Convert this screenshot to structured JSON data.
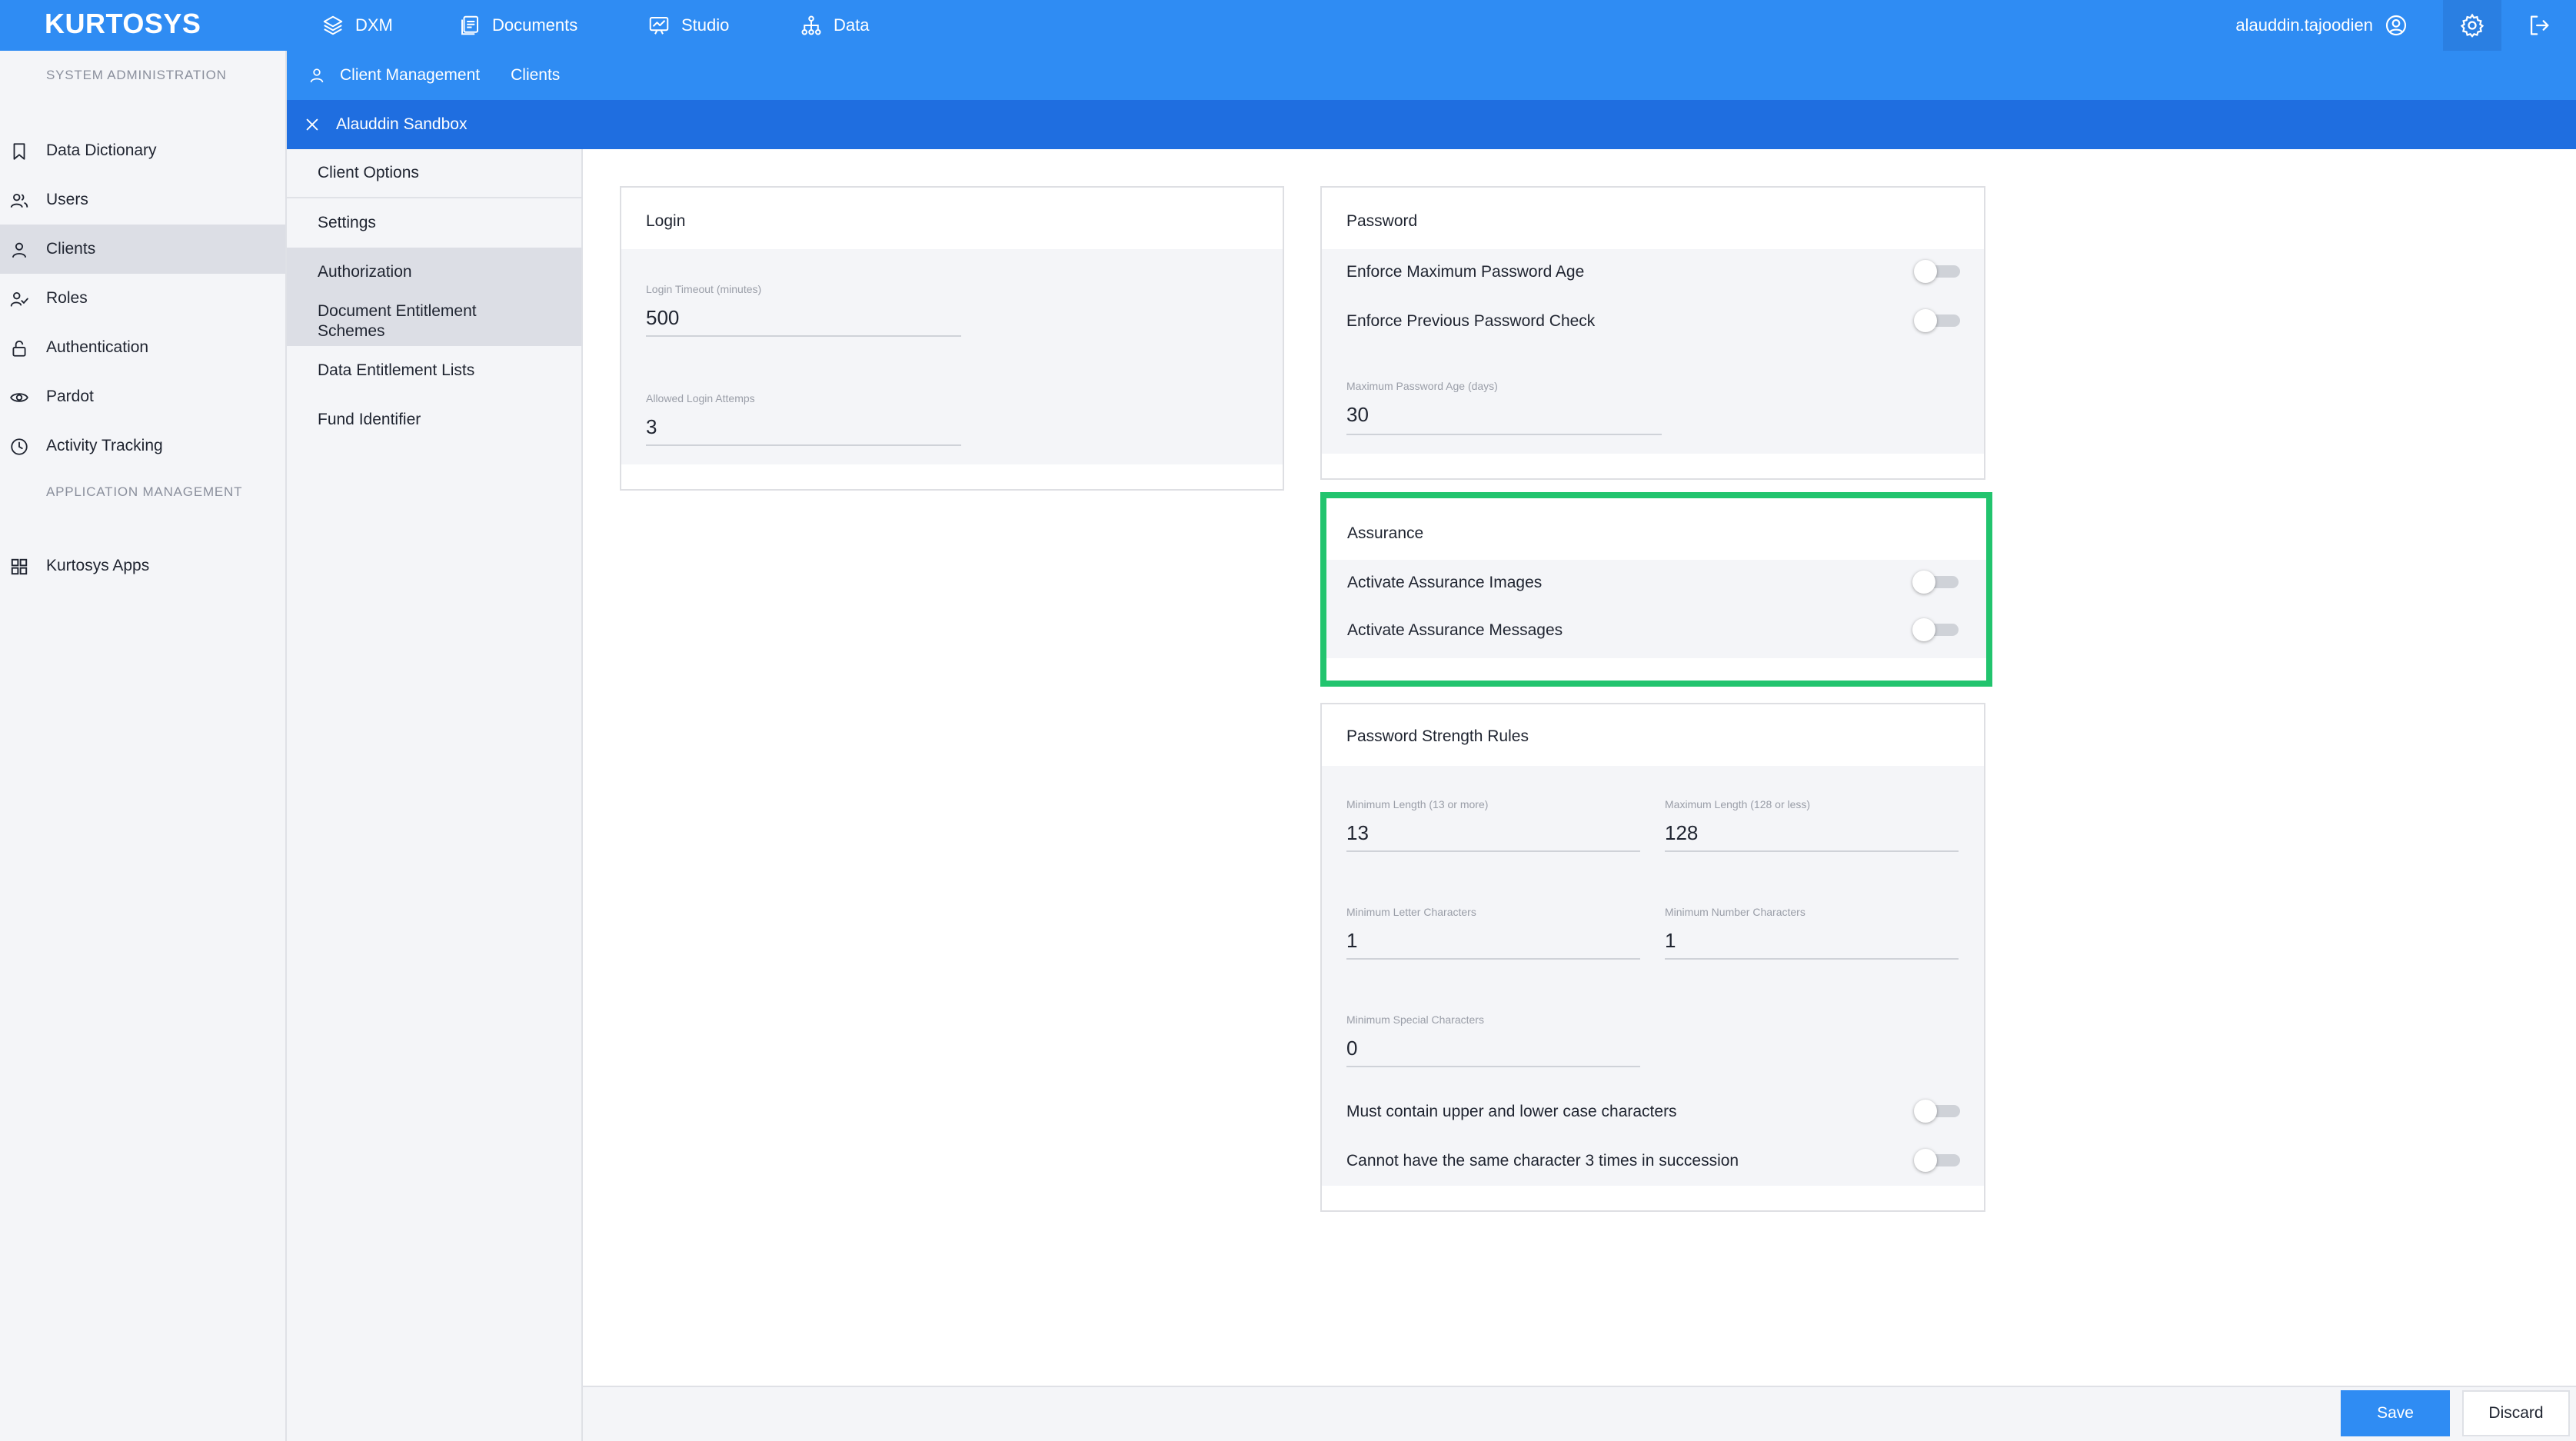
{
  "app": {
    "logo": "KURTOSYS"
  },
  "topnav": [
    {
      "label": "DXM",
      "icon": "layers-icon"
    },
    {
      "label": "Documents",
      "icon": "documents-icon"
    },
    {
      "label": "Studio",
      "icon": "chart-board-icon"
    },
    {
      "label": "Data",
      "icon": "hierarchy-icon"
    }
  ],
  "user": {
    "name": "alauddin.tajoodien",
    "icon": "user-circle-icon"
  },
  "sidebar": {
    "section_system": "SYSTEM ADMINISTRATION",
    "items": [
      {
        "label": "Data Dictionary",
        "icon": "bookmark-icon"
      },
      {
        "label": "Users",
        "icon": "users-icon"
      },
      {
        "label": "Clients",
        "icon": "person-icon",
        "active": true
      },
      {
        "label": "Roles",
        "icon": "person-check-icon"
      },
      {
        "label": "Authentication",
        "icon": "lock-icon"
      },
      {
        "label": "Pardot",
        "icon": "eye-icon"
      },
      {
        "label": "Activity Tracking",
        "icon": "clock-icon"
      }
    ],
    "section_app": "APPLICATION MANAGEMENT",
    "app_items": [
      {
        "label": "Kurtosys Apps",
        "icon": "grid-icon"
      }
    ]
  },
  "breadcrumb": {
    "root": "Client Management",
    "current": "Clients"
  },
  "tab": {
    "label": "Alauddin Sandbox"
  },
  "subnav": [
    {
      "label": "Client Options"
    },
    {
      "label": "Settings"
    },
    {
      "label": "Authorization",
      "active": true
    },
    {
      "label": "Document Entitlement Schemes",
      "active": true
    },
    {
      "label": "Data Entitlement Lists"
    },
    {
      "label": "Fund Identifier"
    }
  ],
  "login": {
    "title": "Login",
    "timeout_label": "Login Timeout (minutes)",
    "timeout_value": "500",
    "attempts_label": "Allowed Login Attemps",
    "attempts_value": "3"
  },
  "password": {
    "title": "Password",
    "enforce_max_age": "Enforce Maximum Password Age",
    "enforce_prev_check": "Enforce Previous Password Check",
    "max_age_label": "Maximum Password Age (days)",
    "max_age_value": "30"
  },
  "assurance": {
    "title": "Assurance",
    "images": "Activate Assurance Images",
    "messages": "Activate Assurance Messages"
  },
  "strength": {
    "title": "Password Strength Rules",
    "min_length_label": "Minimum Length (13 or more)",
    "min_length_value": "13",
    "max_length_label": "Maximum Length (128 or less)",
    "max_length_value": "128",
    "min_letter_label": "Minimum Letter Characters",
    "min_letter_value": "1",
    "min_number_label": "Minimum Number Characters",
    "min_number_value": "1",
    "min_special_label": "Minimum Special Characters",
    "min_special_value": "0",
    "upper_lower": "Must contain upper and lower case characters",
    "no_repeat": "Cannot have the same character 3 times in succession"
  },
  "footer": {
    "save": "Save",
    "discard": "Discard"
  },
  "colors": {
    "primary": "#2f8cf3",
    "tab": "#1f6ee0",
    "highlight": "#22c46e"
  }
}
